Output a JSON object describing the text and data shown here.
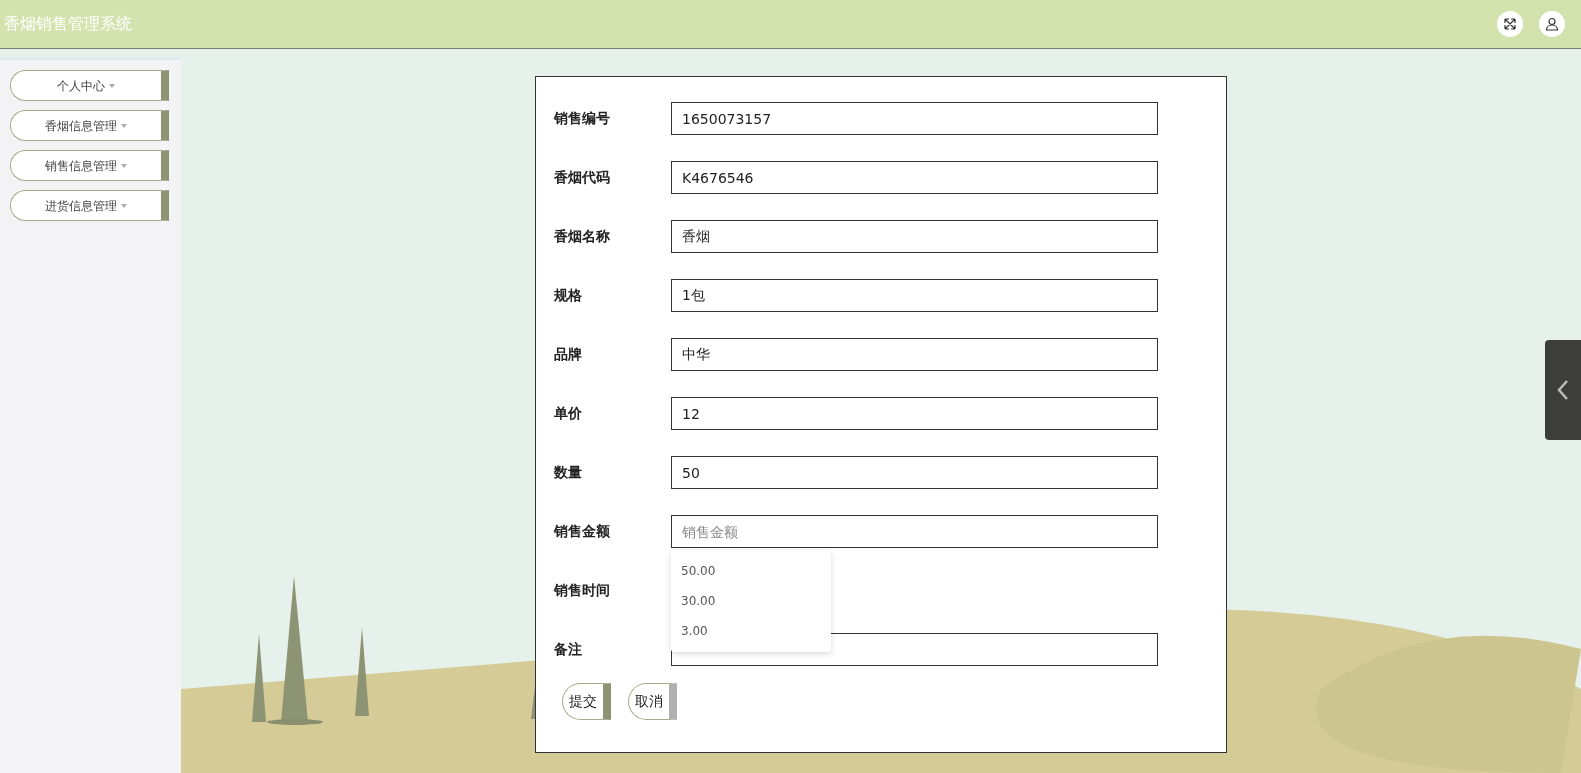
{
  "header": {
    "title": "香烟销售管理系统"
  },
  "sidebar": {
    "items": [
      {
        "label": "个人中心"
      },
      {
        "label": "香烟信息管理"
      },
      {
        "label": "销售信息管理"
      },
      {
        "label": "进货信息管理"
      }
    ]
  },
  "form": {
    "fields": [
      {
        "label": "销售编号",
        "kind": "text",
        "value": "1650073157"
      },
      {
        "label": "香烟代码",
        "kind": "text",
        "value": "K4676546"
      },
      {
        "label": "香烟名称",
        "kind": "text",
        "value": "香烟"
      },
      {
        "label": "规格",
        "kind": "text",
        "value": "1包"
      },
      {
        "label": "品牌",
        "kind": "text",
        "value": "中华"
      },
      {
        "label": "单价",
        "kind": "text",
        "value": "12"
      },
      {
        "label": "数量",
        "kind": "text",
        "value": "50"
      },
      {
        "label": "销售金额",
        "kind": "text",
        "placeholder": "销售金额",
        "suggestions": [
          "50.00",
          "30.00",
          "3.00"
        ]
      },
      {
        "label": "销售时间",
        "kind": "blank"
      },
      {
        "label": "备注",
        "kind": "text"
      }
    ],
    "buttons": [
      {
        "label": "提交",
        "kind": "primary"
      },
      {
        "label": "取消",
        "kind": "secondary"
      }
    ]
  }
}
